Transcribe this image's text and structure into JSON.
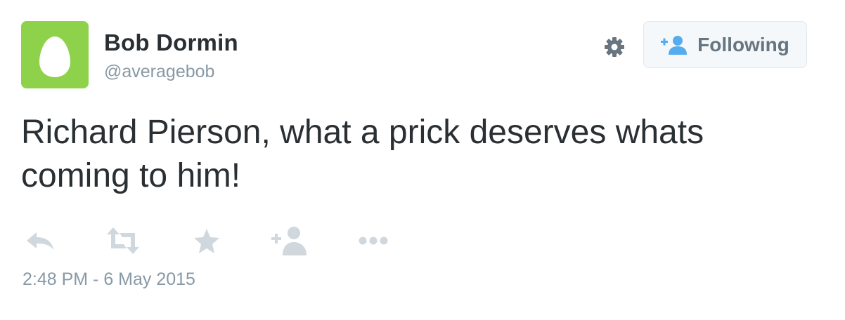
{
  "user": {
    "name": "Bob Dormin",
    "handle": "@averagebob",
    "avatar_color": "#8ed24b",
    "avatar_icon": "egg-avatar-icon"
  },
  "header": {
    "settings_icon": "gear-icon",
    "follow_button": {
      "label": "Following",
      "icon": "follow-person-icon",
      "icon_color": "#55acee"
    }
  },
  "tweet": {
    "text": "Richard Pierson, what a prick deserves whats coming to him!",
    "timestamp": "2:48 PM - 6 May 2015"
  },
  "actions": [
    {
      "name": "reply",
      "icon": "reply-icon"
    },
    {
      "name": "retweet",
      "icon": "retweet-icon"
    },
    {
      "name": "favorite",
      "icon": "star-icon"
    },
    {
      "name": "follow",
      "icon": "add-person-icon"
    },
    {
      "name": "more",
      "icon": "more-dots-icon"
    }
  ],
  "colors": {
    "text": "#292f33",
    "muted": "#8899a6",
    "action_icon": "#d0d8de",
    "accent": "#55acee"
  }
}
